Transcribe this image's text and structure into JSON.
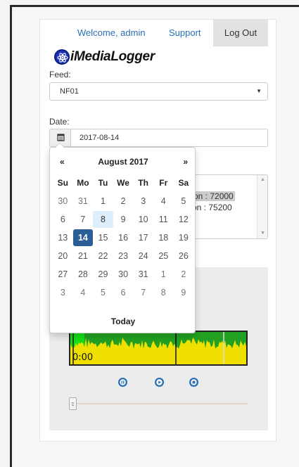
{
  "header": {
    "welcome": "Welcome, admin",
    "support": "Support",
    "logout": "Log Out"
  },
  "brand": {
    "name": "iMediaLogger",
    "icon": "atom-logo-icon"
  },
  "feed": {
    "label": "Feed:",
    "value": "NF01"
  },
  "date": {
    "label": "Date:",
    "value": "2017-08-14",
    "icon": "calendar-icon"
  },
  "list": {
    "items": [
      "tion : 72000",
      "tion : 75200"
    ]
  },
  "player": {
    "time": "0:00",
    "controls": [
      "pause-icon",
      "play-icon",
      "stop-icon"
    ],
    "position": 0.0
  },
  "calendar": {
    "prev": "«",
    "title": "August 2017",
    "next": "»",
    "days_of_week": [
      "Su",
      "Mo",
      "Tu",
      "We",
      "Th",
      "Fr",
      "Sa"
    ],
    "weeks": [
      [
        "30",
        "31",
        "1",
        "2",
        "3",
        "4",
        "5"
      ],
      [
        "6",
        "7",
        "8",
        "9",
        "10",
        "11",
        "12"
      ],
      [
        "13",
        "14",
        "15",
        "16",
        "17",
        "18",
        "19"
      ],
      [
        "20",
        "21",
        "22",
        "23",
        "24",
        "25",
        "26"
      ],
      [
        "27",
        "28",
        "29",
        "30",
        "31",
        "1",
        "2"
      ],
      [
        "3",
        "4",
        "5",
        "6",
        "7",
        "8",
        "9"
      ]
    ],
    "selected": "14",
    "highlighted": "8",
    "today_label": "Today"
  },
  "colors": {
    "link": "#2a6fb5",
    "selected_day": "#2b5e96",
    "highlight_day": "#ddeefc",
    "waveform_bg": "#22a022",
    "waveform_fill": "#f0e000"
  }
}
